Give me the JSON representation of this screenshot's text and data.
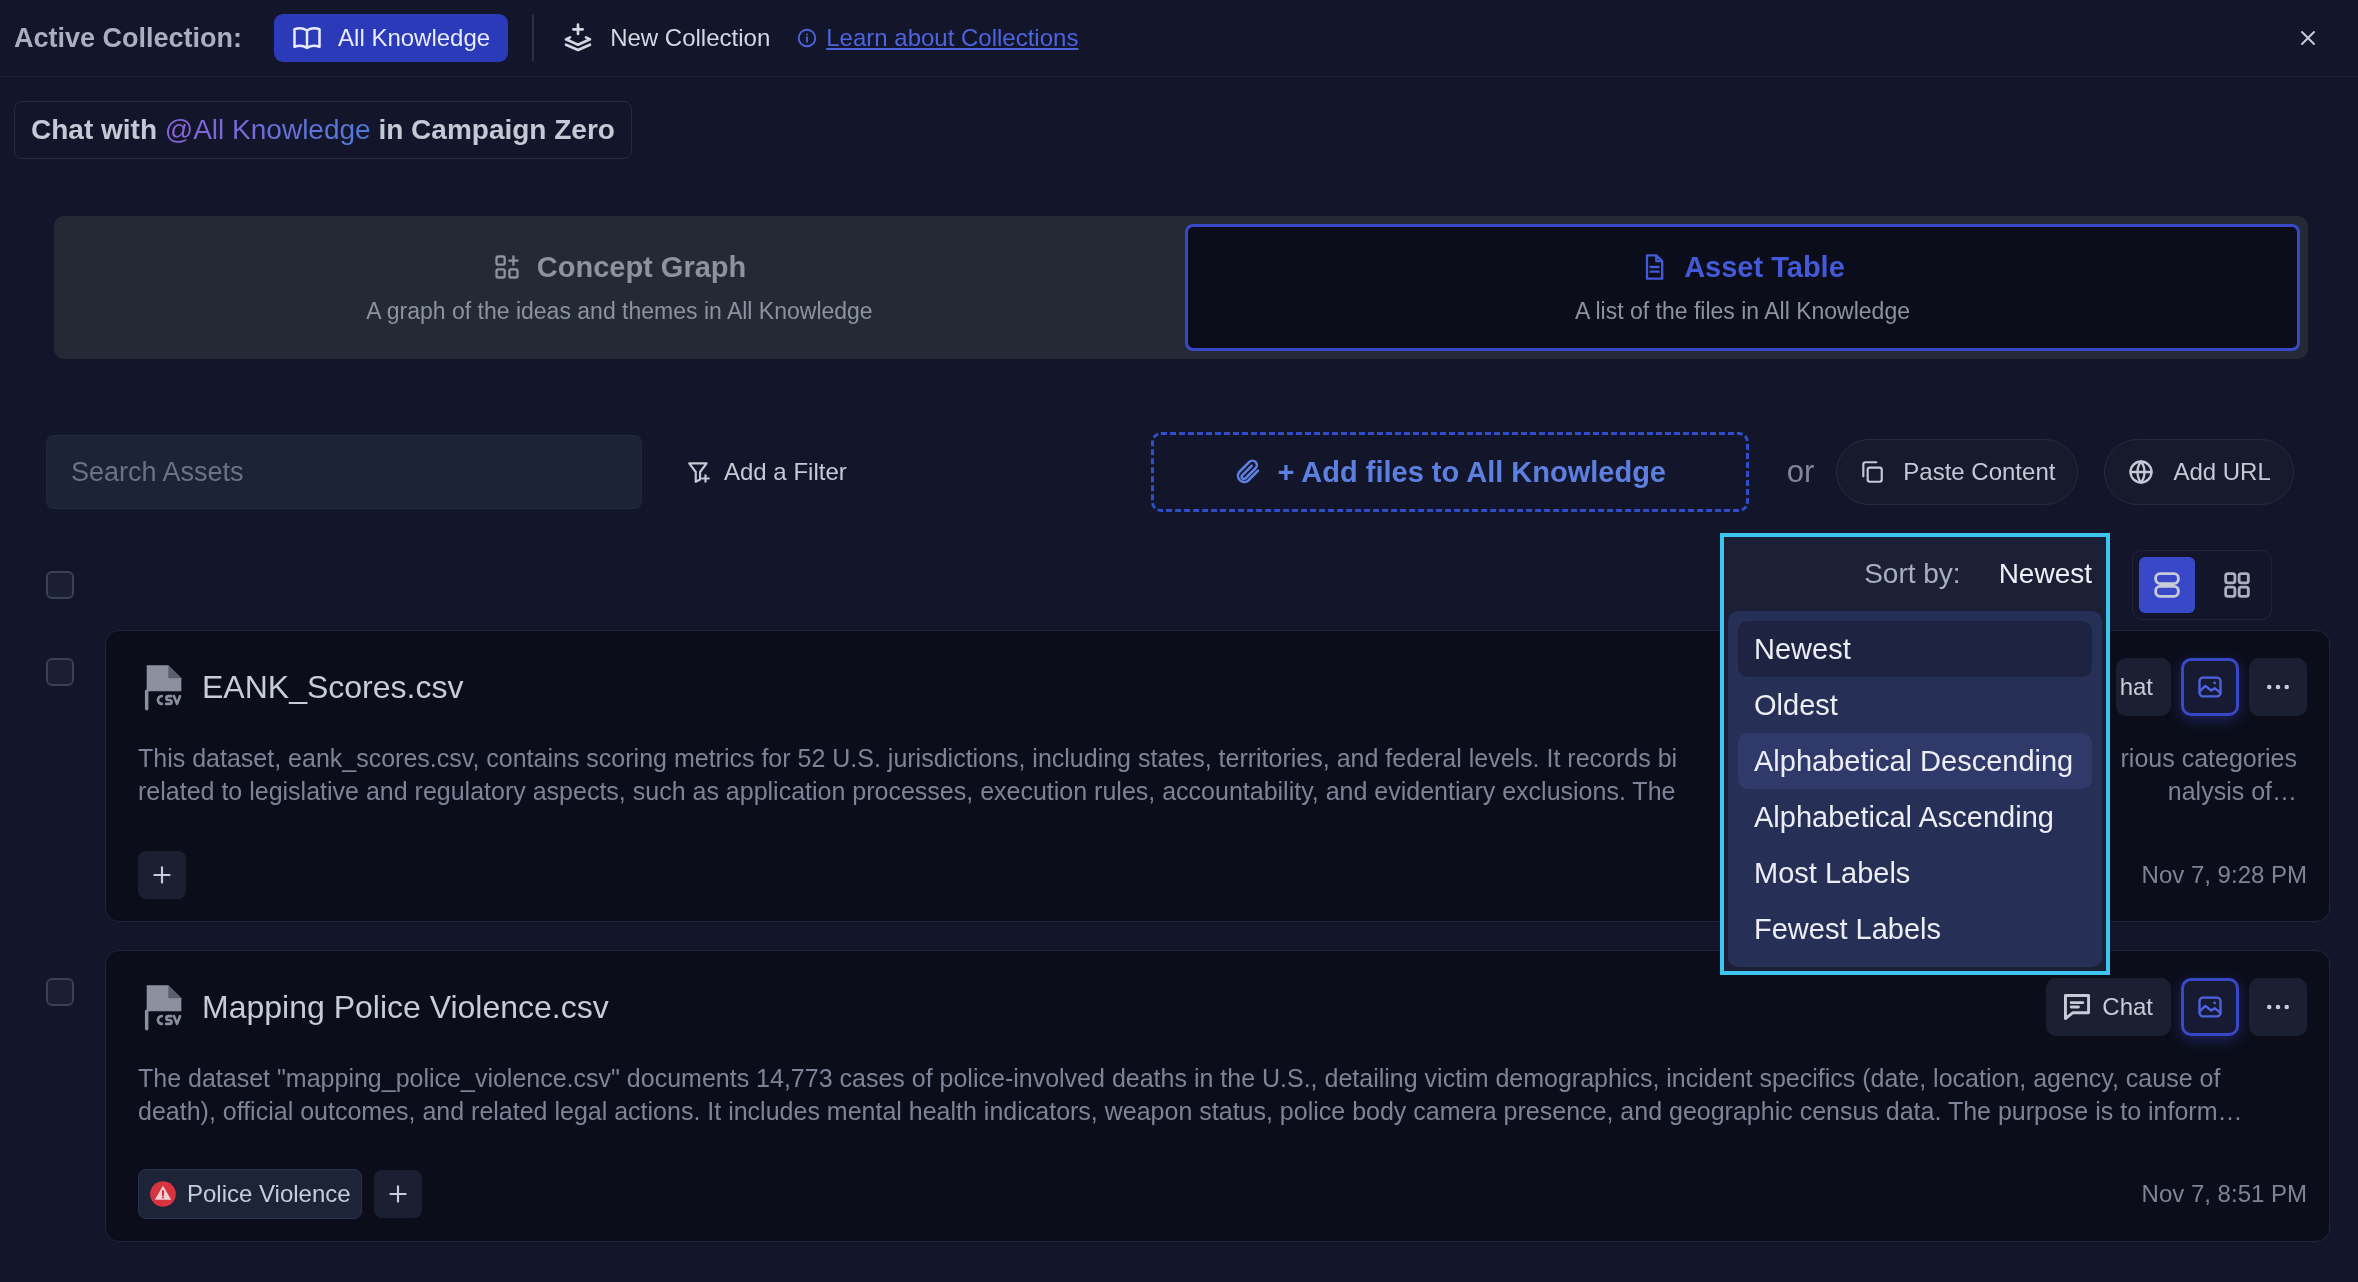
{
  "top_bar": {
    "label": "Active Collection:",
    "active_collection": {
      "label": "All Knowledge",
      "selected": true
    },
    "new_collection": "New Collection",
    "learn_link": "Learn about Collections"
  },
  "chat_context": {
    "prefix": "Chat with",
    "mention": "@All Knowledge",
    "middle": "in",
    "collection": "Campaign Zero"
  },
  "view_tabs": [
    {
      "kind": "graph",
      "title": "Concept Graph",
      "subtitle": "A graph of the ideas and themes in All Knowledge",
      "selected": false
    },
    {
      "kind": "table",
      "title": "Asset Table",
      "subtitle": "A list of the files in All Knowledge",
      "selected": true
    }
  ],
  "toolbar": {
    "search": {
      "placeholder": "Search Assets"
    },
    "filter_button": "Add a Filter",
    "add_files_button": "+ Add files to All Knowledge",
    "or": "or",
    "paste_button": "Paste Content",
    "url_button": "Add URL"
  },
  "select_all": {
    "checked": false
  },
  "sort": {
    "label": "Sort by:",
    "value": "Newest",
    "expanded": true,
    "options": [
      {
        "label": "Newest",
        "selected": true,
        "highlighted": false
      },
      {
        "label": "Oldest",
        "selected": false,
        "highlighted": false
      },
      {
        "label": "Alphabetical Descending",
        "selected": false,
        "highlighted": true
      },
      {
        "label": "Alphabetical Ascending",
        "selected": false,
        "highlighted": false
      },
      {
        "label": "Most Labels",
        "selected": false,
        "highlighted": false
      },
      {
        "label": "Fewest Labels",
        "selected": false,
        "highlighted": false
      }
    ]
  },
  "view_modes": [
    {
      "kind": "list",
      "selected": true
    },
    {
      "kind": "grid",
      "selected": false
    }
  ],
  "assets": [
    {
      "checked": false,
      "name": "EANK_Scores.csv",
      "chat_button": "hat",
      "preview_selected": true,
      "description_lines": [
        [
          "This dataset, eank_scores.csv, contains scoring metrics for 52 U.S. jurisdictions, including states, territories, and federal levels. It records bi",
          "rious categories"
        ],
        [
          "related to legislative and regulatory aspects, such as application processes, execution rules, accountability, and evidentiary exclusions. The",
          "nalysis of…"
        ]
      ],
      "date": "Nov 7, 9:28 PM"
    },
    {
      "checked": false,
      "name": "Mapping Police Violence.csv",
      "chat_button": "Chat",
      "preview_selected": true,
      "description_lines": [
        [
          "The dataset \"mapping_police_violence.csv\" documents 14,773 cases of police-involved deaths in the U.S., detailing victim demographics, incident specifics (date, location, agency, cause of"
        ],
        [
          "death), official outcomes, and related legal actions. It includes mental health indicators, weapon status, police body camera presence, and geographic census data. The purpose is to inform…"
        ]
      ],
      "labels": [
        {
          "text": "Police Violence",
          "color": "#d8343f"
        }
      ],
      "date": "Nov 7, 8:51 PM"
    }
  ]
}
